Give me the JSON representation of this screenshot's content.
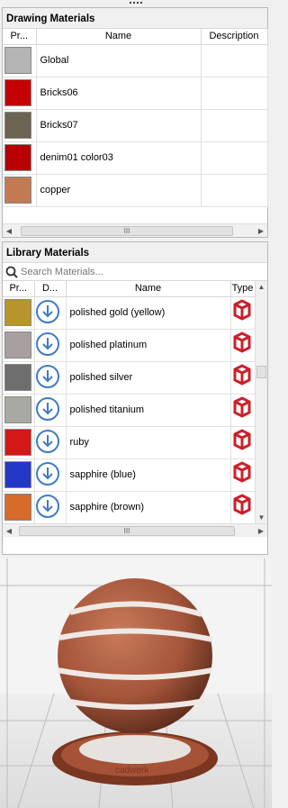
{
  "drawing_panel": {
    "title": "Drawing Materials",
    "columns": [
      "Pr...",
      "Name",
      "Description"
    ],
    "rows": [
      {
        "name": "Global",
        "swatch": "#b4b4b4"
      },
      {
        "name": "Bricks06",
        "swatch": "#c40000"
      },
      {
        "name": "Bricks07",
        "swatch": "#6b6450"
      },
      {
        "name": "denim01 color03",
        "swatch": "#b80000"
      },
      {
        "name": "copper",
        "swatch": "#c27a52"
      }
    ],
    "scroll_thumb": "III"
  },
  "library_panel": {
    "title": "Library Materials",
    "search_placeholder": "Search Materials...",
    "columns": [
      "Pr...",
      "D...",
      "Name",
      "Type"
    ],
    "rows": [
      {
        "name": "polished gold (yellow)",
        "swatch": "#b8952c"
      },
      {
        "name": "polished platinum",
        "swatch": "#a8a0a0"
      },
      {
        "name": "polished silver",
        "swatch": "#6e6e6e"
      },
      {
        "name": "polished titanium",
        "swatch": "#a9a9a3"
      },
      {
        "name": "ruby",
        "swatch": "#d41818"
      },
      {
        "name": "sapphire (blue)",
        "swatch": "#2438c8"
      },
      {
        "name": "sapphire (brown)",
        "swatch": "#d86a2a"
      }
    ],
    "scroll_thumb": "III",
    "download_icon": "download-arrow-icon",
    "type_icon": "red-cube-icon",
    "accent": "#3f7bc4",
    "type_color": "#cc1f2a"
  },
  "preview": {
    "label": "cadwerk"
  }
}
